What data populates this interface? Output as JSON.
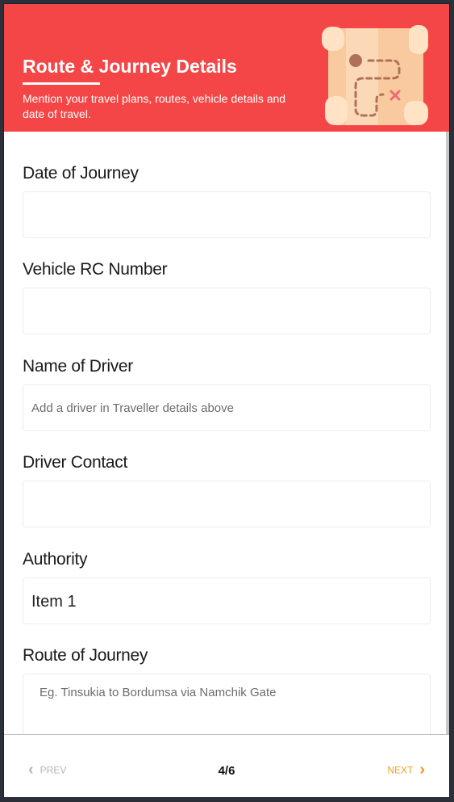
{
  "header": {
    "title": "Route & Journey Details",
    "subtitle": "Mention your travel plans, routes, vehicle details and date of travel.",
    "background_color": "#f44646",
    "illustration": "treasure-map-icon"
  },
  "form": {
    "date_of_journey": {
      "label": "Date of Journey",
      "value": ""
    },
    "vehicle_rc_number": {
      "label": "Vehicle RC Number",
      "value": ""
    },
    "name_of_driver": {
      "label": "Name of Driver",
      "placeholder": "Add a driver in Traveller details above"
    },
    "driver_contact": {
      "label": "Driver Contact",
      "value": ""
    },
    "authority": {
      "label": "Authority",
      "selected": "Item 1"
    },
    "route_of_journey": {
      "label": "Route of Journey",
      "placeholder": "Eg. Tinsukia to Bordumsa via Namchik Gate"
    }
  },
  "footer": {
    "prev_label": "PREV",
    "page_indicator": "4/6",
    "next_label": "NEXT",
    "prev_icon": "chevron-left-icon",
    "next_icon": "chevron-right-icon",
    "accent_color": "#f4a020"
  }
}
